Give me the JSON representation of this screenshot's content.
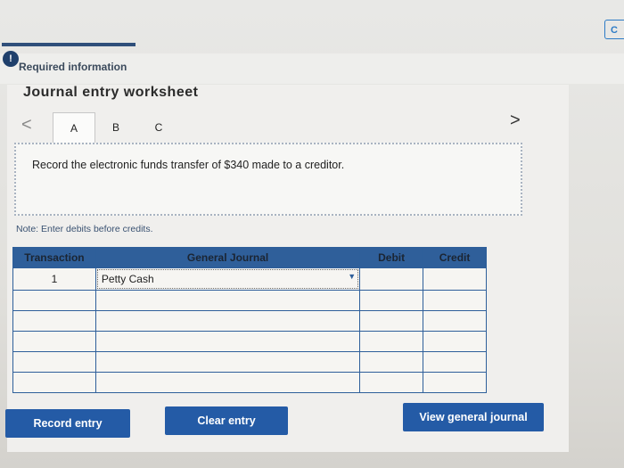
{
  "header": {
    "info_icon": "!",
    "required_label": "Required information",
    "corner_label": "C"
  },
  "worksheet": {
    "title": "Journal entry worksheet",
    "nav_prev": "<",
    "nav_next": ">",
    "tabs": [
      {
        "label": "A",
        "active": true
      },
      {
        "label": "B",
        "active": false
      },
      {
        "label": "C",
        "active": false
      }
    ],
    "instruction": "Record the electronic funds transfer of $340 made to a creditor.",
    "note": "Note: Enter debits before credits."
  },
  "journal": {
    "columns": [
      "Transaction",
      "General Journal",
      "Debit",
      "Credit"
    ],
    "rows": [
      {
        "transaction": "1",
        "account": "Petty Cash",
        "debit": "",
        "credit": ""
      },
      {
        "transaction": "",
        "account": "",
        "debit": "",
        "credit": ""
      },
      {
        "transaction": "",
        "account": "",
        "debit": "",
        "credit": ""
      },
      {
        "transaction": "",
        "account": "",
        "debit": "",
        "credit": ""
      },
      {
        "transaction": "",
        "account": "",
        "debit": "",
        "credit": ""
      },
      {
        "transaction": "",
        "account": "",
        "debit": "",
        "credit": ""
      }
    ]
  },
  "buttons": {
    "record": "Record entry",
    "clear": "Clear entry",
    "view": "View general journal"
  },
  "colors": {
    "accent": "#245ba6",
    "header_blue": "#2f5f9a"
  }
}
